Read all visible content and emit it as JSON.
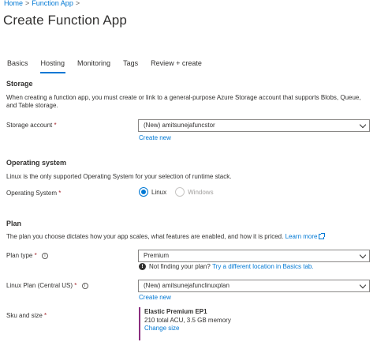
{
  "breadcrumb": {
    "items": [
      "Home",
      "Function App"
    ],
    "separator": ">"
  },
  "page": {
    "title": "Create Function App"
  },
  "tabs": [
    {
      "label": "Basics"
    },
    {
      "label": "Hosting",
      "active": true
    },
    {
      "label": "Monitoring"
    },
    {
      "label": "Tags"
    },
    {
      "label": "Review + create"
    }
  ],
  "storage": {
    "section_title": "Storage",
    "description": "When creating a function app, you must create or link to a general-purpose Azure Storage account that supports Blobs, Queue, and Table storage.",
    "account_label": "Storage account",
    "required_mark": "*",
    "account_value": "(New) amitsunejafuncstor",
    "create_new": "Create new"
  },
  "os": {
    "section_title": "Operating system",
    "description": "Linux is the only supported Operating System for your selection of runtime stack.",
    "label": "Operating System",
    "required_mark": "*",
    "options": [
      {
        "label": "Linux",
        "selected": true,
        "disabled": false
      },
      {
        "label": "Windows",
        "selected": false,
        "disabled": true
      }
    ]
  },
  "plan": {
    "section_title": "Plan",
    "description": "The plan you choose dictates how your app scales, what features are enabled, and how it is priced.",
    "learn_more": "Learn more",
    "type_label": "Plan type",
    "required_mark": "*",
    "type_value": "Premium",
    "not_finding": "Not finding your plan?",
    "try_link": "Try a different location in Basics tab.",
    "linux_plan_label": "Linux Plan (Central US)",
    "linux_plan_value": "(New) amitsunejafunclinuxplan",
    "create_new": "Create new",
    "sku_label": "Sku and size",
    "sku_title": "Elastic Premium EP1",
    "sku_detail": "210 total ACU, 3.5 GB memory",
    "change_size": "Change size"
  },
  "colors": {
    "accent": "#0078d4",
    "required": "#a4262c",
    "sku_bar": "#8b2e7f"
  },
  "icons": [
    "chevron-right-icon",
    "chevron-down-icon",
    "info-icon",
    "external-link-icon",
    "info-filled-icon"
  ]
}
